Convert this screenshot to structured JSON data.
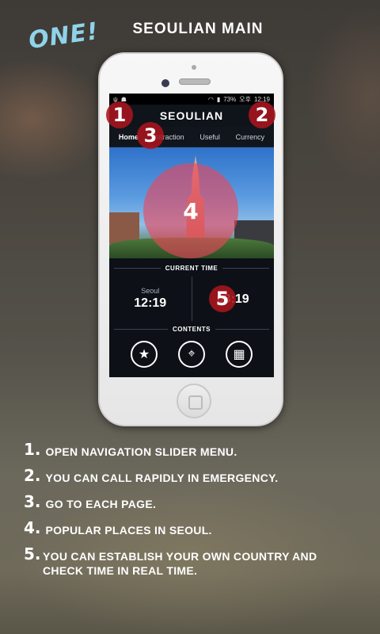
{
  "brand": {
    "logo_text": "ONE!"
  },
  "page": {
    "title": "SEOULIAN MAIN"
  },
  "status_bar": {
    "battery": "73%",
    "time_prefix": "오후",
    "time": "12:19"
  },
  "app": {
    "title": "SEOULIAN",
    "tabs": [
      {
        "label": "Home",
        "active": true
      },
      {
        "label": "Attraction",
        "active": false
      },
      {
        "label": "Useful",
        "active": false
      },
      {
        "label": "Currency",
        "active": false
      }
    ],
    "clock": {
      "label": "CURRENT TIME",
      "left": {
        "city": "Seoul",
        "time": "12:19"
      },
      "right": {
        "city": "",
        "time": "03:19"
      }
    },
    "contents": {
      "label": "CONTENTS",
      "icons": [
        "star-icon",
        "map-pin-icon",
        "qr-code-icon"
      ]
    }
  },
  "markers": [
    "1",
    "2",
    "3",
    "4",
    "5"
  ],
  "instructions": [
    {
      "num": "1.",
      "text": "OPEN NAVIGATION SLIDER MENU."
    },
    {
      "num": "2.",
      "text": "YOU CAN CALL RAPIDLY IN EMERGENCY."
    },
    {
      "num": "3.",
      "text": "GO TO EACH PAGE."
    },
    {
      "num": "4.",
      "text": "POPULAR PLACES IN SEOUL."
    },
    {
      "num": "5.",
      "text": "YOU CAN ESTABLISH YOUR OWN COUNTRY AND CHECK TIME IN REAL TIME."
    }
  ],
  "colors": {
    "logo": "#8fd3ea",
    "marker": "#aa141e",
    "marker_large": "#eb465a"
  }
}
